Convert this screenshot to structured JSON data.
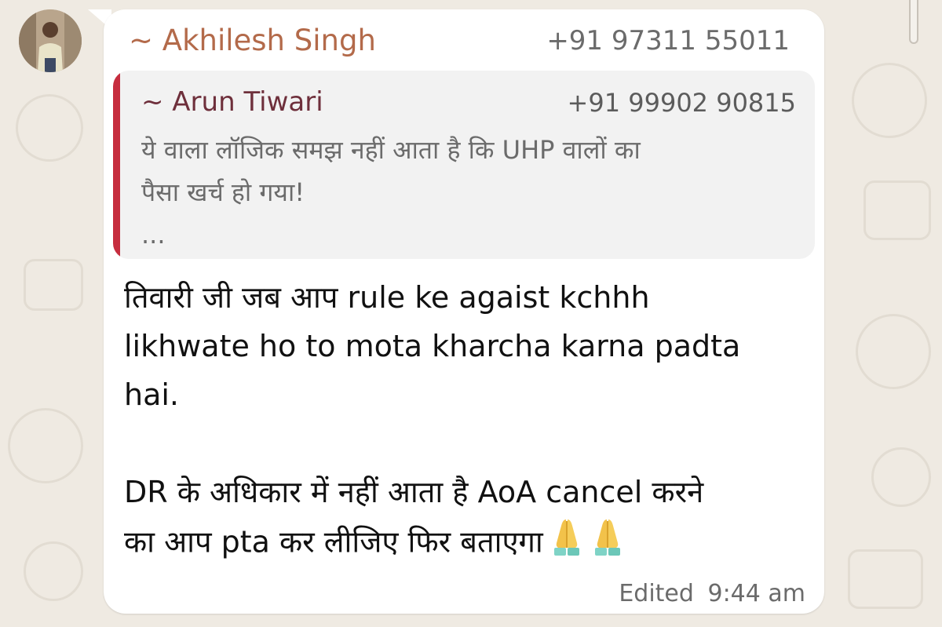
{
  "message": {
    "sender_name": "~ Akhilesh Singh",
    "sender_phone": "+91 97311 55011",
    "quoted": {
      "name": "~ Arun Tiwari",
      "phone": "+91 99902 90815",
      "lines": [
        "ये वाला लॉजिक समझ नहीं आता है कि UHP वालों का",
        "पैसा खर्च हो गया!",
        "..."
      ]
    },
    "body_lines": [
      "तिवारी जी जब आप rule ke agaist kchhh",
      "likhwate ho to mota kharcha karna padta",
      "hai.",
      "DR के अधिकार में नहीं आता है AoA cancel करने",
      "का आप pta कर लीजिए फिर बताएगा"
    ],
    "emojis": [
      "folded-hands-icon",
      "folded-hands-icon"
    ],
    "edited_label": "Edited",
    "time": "9:44 am"
  },
  "colors": {
    "sender_name": "#b36a4a",
    "quote_bar": "#c62d3e",
    "quote_name": "#6e2f3b",
    "background": "#efeae2",
    "bubble": "#ffffff"
  }
}
